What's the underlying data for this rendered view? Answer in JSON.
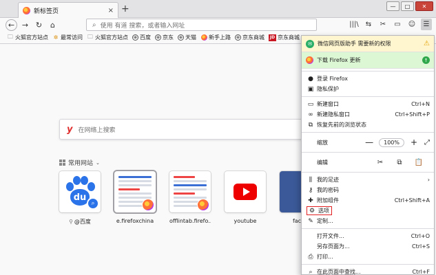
{
  "tab": {
    "title": "新标签页",
    "close": "×",
    "new_tab": "+"
  },
  "window_buttons": {
    "minimize": "—",
    "maximize": "□",
    "close": "✕"
  },
  "nav": {
    "back": "←",
    "forward": "→",
    "reload": "↻",
    "home": "⌂",
    "url_placeholder": "使用 有道 搜索，或者输入网址"
  },
  "toolbar": {
    "library": "|||\\",
    "sync": "⇆",
    "screenshot": "✂",
    "reader": "▭",
    "account": "☺",
    "menu": "☰"
  },
  "bookmarks": [
    {
      "label": "火狐官方站点",
      "icon": "folder"
    },
    {
      "label": "最常访问",
      "icon": "star"
    },
    {
      "label": "火狐官方站点",
      "icon": "folder"
    },
    {
      "label": "百度",
      "icon": "globe"
    },
    {
      "label": "京东",
      "icon": "globe"
    },
    {
      "label": "天猫",
      "icon": "globe"
    },
    {
      "label": "新手上路",
      "icon": "firefox"
    },
    {
      "label": "京东商城",
      "icon": "globe"
    },
    {
      "label": "京东商城",
      "icon": "jd"
    }
  ],
  "search": {
    "placeholder": "在网络上搜索"
  },
  "top_sites": {
    "heading": "常用网站",
    "tiles": [
      {
        "label": "@百度",
        "pinned": true
      },
      {
        "label": "e.firefoxchina"
      },
      {
        "label": "offlintab.firefo..."
      },
      {
        "label": "youtube"
      },
      {
        "label": "faceb"
      }
    ]
  },
  "menu": {
    "banner_wechat": "微信网页版助手 需要新的权限",
    "banner_update": "下载 Firefox 更新",
    "login": "登录 Firefox",
    "privacy": "隐私保护",
    "new_window": {
      "label": "新建窗口",
      "shortcut": "Ctrl+N"
    },
    "new_private": {
      "label": "新建隐私窗口",
      "shortcut": "Ctrl+Shift+P"
    },
    "restore": "恢复先前的浏览状态",
    "zoom": {
      "label": "缩放",
      "minus": "—",
      "value": "100%",
      "plus": "+",
      "fullscreen": "⤢"
    },
    "edit": {
      "label": "编辑",
      "cut": "✂",
      "copy": "⧉",
      "paste": "📋"
    },
    "library": "我的足迹",
    "passwords": "我的密码",
    "addons": {
      "label": "附加组件",
      "shortcut": "Ctrl+Shift+A"
    },
    "options": "选项",
    "customize": "定制...",
    "open_file": {
      "label": "打开文件...",
      "shortcut": "Ctrl+O"
    },
    "save_as": {
      "label": "另存页面为...",
      "shortcut": "Ctrl+S"
    },
    "print": "打印...",
    "find": {
      "label": "在此页面中查找...",
      "shortcut": "Ctrl+F"
    }
  }
}
